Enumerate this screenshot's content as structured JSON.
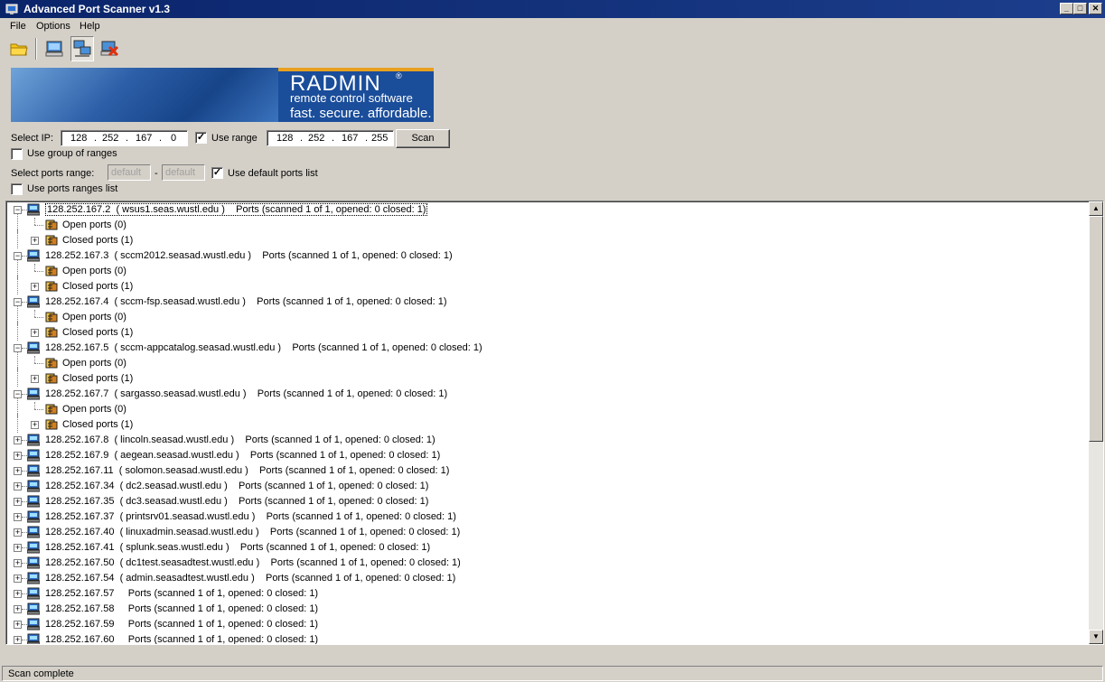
{
  "window": {
    "title": "Advanced Port Scanner v1.3",
    "controls": {
      "minimize": "_",
      "maximize": "□",
      "close": "✕"
    }
  },
  "menu": {
    "items": [
      "File",
      "Options",
      "Help"
    ]
  },
  "toolbar": {
    "icons": [
      "open-folder-icon",
      "scan-computer-icon",
      "network-computers-icon",
      "stop-scan-icon"
    ]
  },
  "banner": {
    "brand": "RADMIN",
    "registered": "®",
    "tagline1": "remote control software",
    "tagline2": "fast. secure. affordable."
  },
  "form": {
    "select_ip_label": "Select IP:",
    "ip_from": [
      "128",
      "252",
      "167",
      "0"
    ],
    "use_range_label": "Use range",
    "use_range_checked": true,
    "ip_to": [
      "128",
      "252",
      "167",
      "255"
    ],
    "scan_button": "Scan",
    "use_group_label": "Use group of ranges",
    "use_group_checked": false,
    "ports_range_label": "Select ports range:",
    "ports_from_placeholder": "default",
    "ports_separator": "-",
    "ports_to_placeholder": "default",
    "use_default_ports_label": "Use default ports list",
    "use_default_ports_checked": true,
    "use_ports_ranges_label": "Use ports ranges list",
    "use_ports_ranges_checked": false
  },
  "tree": {
    "rows": [
      {
        "level": 0,
        "expanded": true,
        "text": "128.252.167.2  ( wsus1.seas.wustl.edu )    Ports (scanned 1 of 1, opened: 0 closed: 1)",
        "selected": true
      },
      {
        "level": 1,
        "expander": false,
        "text": "Open ports (0)"
      },
      {
        "level": 1,
        "expander": true,
        "text": "Closed ports (1)"
      },
      {
        "level": 0,
        "expanded": true,
        "text": "128.252.167.3  ( sccm2012.seasad.wustl.edu )    Ports (scanned 1 of 1, opened: 0 closed: 1)"
      },
      {
        "level": 1,
        "expander": false,
        "text": "Open ports (0)"
      },
      {
        "level": 1,
        "expander": true,
        "text": "Closed ports (1)"
      },
      {
        "level": 0,
        "expanded": true,
        "text": "128.252.167.4  ( sccm-fsp.seasad.wustl.edu )    Ports (scanned 1 of 1, opened: 0 closed: 1)"
      },
      {
        "level": 1,
        "expander": false,
        "text": "Open ports (0)"
      },
      {
        "level": 1,
        "expander": true,
        "text": "Closed ports (1)"
      },
      {
        "level": 0,
        "expanded": true,
        "text": "128.252.167.5  ( sccm-appcatalog.seasad.wustl.edu )    Ports (scanned 1 of 1, opened: 0 closed: 1)"
      },
      {
        "level": 1,
        "expander": false,
        "text": "Open ports (0)"
      },
      {
        "level": 1,
        "expander": true,
        "text": "Closed ports (1)"
      },
      {
        "level": 0,
        "expanded": true,
        "text": "128.252.167.7  ( sargasso.seasad.wustl.edu )    Ports (scanned 1 of 1, opened: 0 closed: 1)"
      },
      {
        "level": 1,
        "expander": false,
        "text": "Open ports (0)"
      },
      {
        "level": 1,
        "expander": true,
        "text": "Closed ports (1)"
      },
      {
        "level": 0,
        "expanded": false,
        "text": "128.252.167.8  ( lincoln.seasad.wustl.edu )    Ports (scanned 1 of 1, opened: 0 closed: 1)"
      },
      {
        "level": 0,
        "expanded": false,
        "text": "128.252.167.9  ( aegean.seasad.wustl.edu )    Ports (scanned 1 of 1, opened: 0 closed: 1)"
      },
      {
        "level": 0,
        "expanded": false,
        "text": "128.252.167.11  ( solomon.seasad.wustl.edu )    Ports (scanned 1 of 1, opened: 0 closed: 1)"
      },
      {
        "level": 0,
        "expanded": false,
        "text": "128.252.167.34  ( dc2.seasad.wustl.edu )    Ports (scanned 1 of 1, opened: 0 closed: 1)"
      },
      {
        "level": 0,
        "expanded": false,
        "text": "128.252.167.35  ( dc3.seasad.wustl.edu )    Ports (scanned 1 of 1, opened: 0 closed: 1)"
      },
      {
        "level": 0,
        "expanded": false,
        "text": "128.252.167.37  ( printsrv01.seasad.wustl.edu )    Ports (scanned 1 of 1, opened: 0 closed: 1)"
      },
      {
        "level": 0,
        "expanded": false,
        "text": "128.252.167.40  ( linuxadmin.seasad.wustl.edu )    Ports (scanned 1 of 1, opened: 0 closed: 1)"
      },
      {
        "level": 0,
        "expanded": false,
        "text": "128.252.167.41  ( splunk.seas.wustl.edu )    Ports (scanned 1 of 1, opened: 0 closed: 1)"
      },
      {
        "level": 0,
        "expanded": false,
        "text": "128.252.167.50  ( dc1test.seasadtest.wustl.edu )    Ports (scanned 1 of 1, opened: 0 closed: 1)"
      },
      {
        "level": 0,
        "expanded": false,
        "text": "128.252.167.54  ( admin.seasadtest.wustl.edu )    Ports (scanned 1 of 1, opened: 0 closed: 1)"
      },
      {
        "level": 0,
        "expanded": false,
        "text": "128.252.167.57     Ports (scanned 1 of 1, opened: 0 closed: 1)"
      },
      {
        "level": 0,
        "expanded": false,
        "text": "128.252.167.58     Ports (scanned 1 of 1, opened: 0 closed: 1)"
      },
      {
        "level": 0,
        "expanded": false,
        "text": "128.252.167.59     Ports (scanned 1 of 1, opened: 0 closed: 1)"
      },
      {
        "level": 0,
        "expanded": false,
        "text": "128.252.167.60     Ports (scanned 1 of 1, opened: 0 closed: 1)"
      }
    ]
  },
  "scrollbar": {
    "up": "▲",
    "down": "▼"
  },
  "status": {
    "text": "Scan complete"
  }
}
